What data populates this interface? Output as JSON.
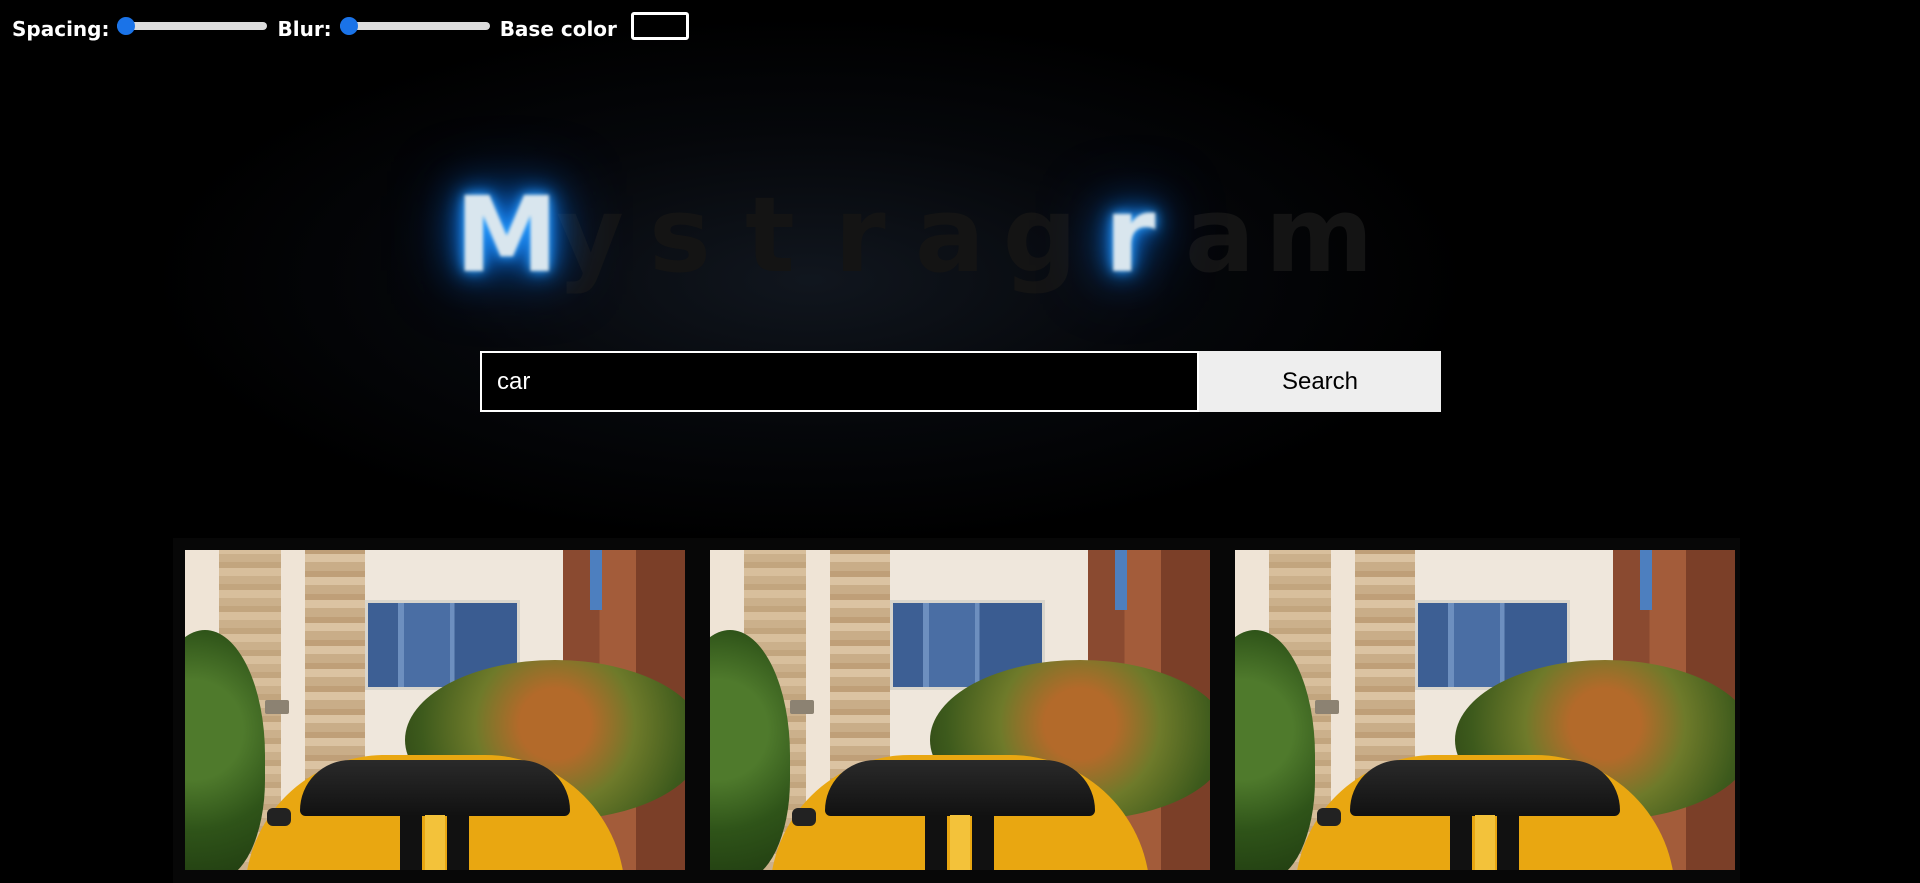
{
  "controls": {
    "spacing_label": "Spacing:",
    "spacing_value": 0,
    "blur_label": "Blur:",
    "blur_value": 0,
    "base_color_label": "Base color",
    "base_color_value": "#000000",
    "accent_color": "#1a73e8"
  },
  "logo": {
    "letters": [
      "M",
      "y",
      "s",
      "t",
      "r",
      "a",
      "g",
      "r",
      "a",
      "m"
    ],
    "lit_indices": [
      0,
      7
    ],
    "glow_color": "#1b88ff"
  },
  "search": {
    "query": "car",
    "button_label": "Search"
  },
  "results": {
    "items": [
      {
        "subject": "yellow-car-photo"
      },
      {
        "subject": "yellow-car-photo"
      },
      {
        "subject": "yellow-car-photo"
      }
    ]
  }
}
